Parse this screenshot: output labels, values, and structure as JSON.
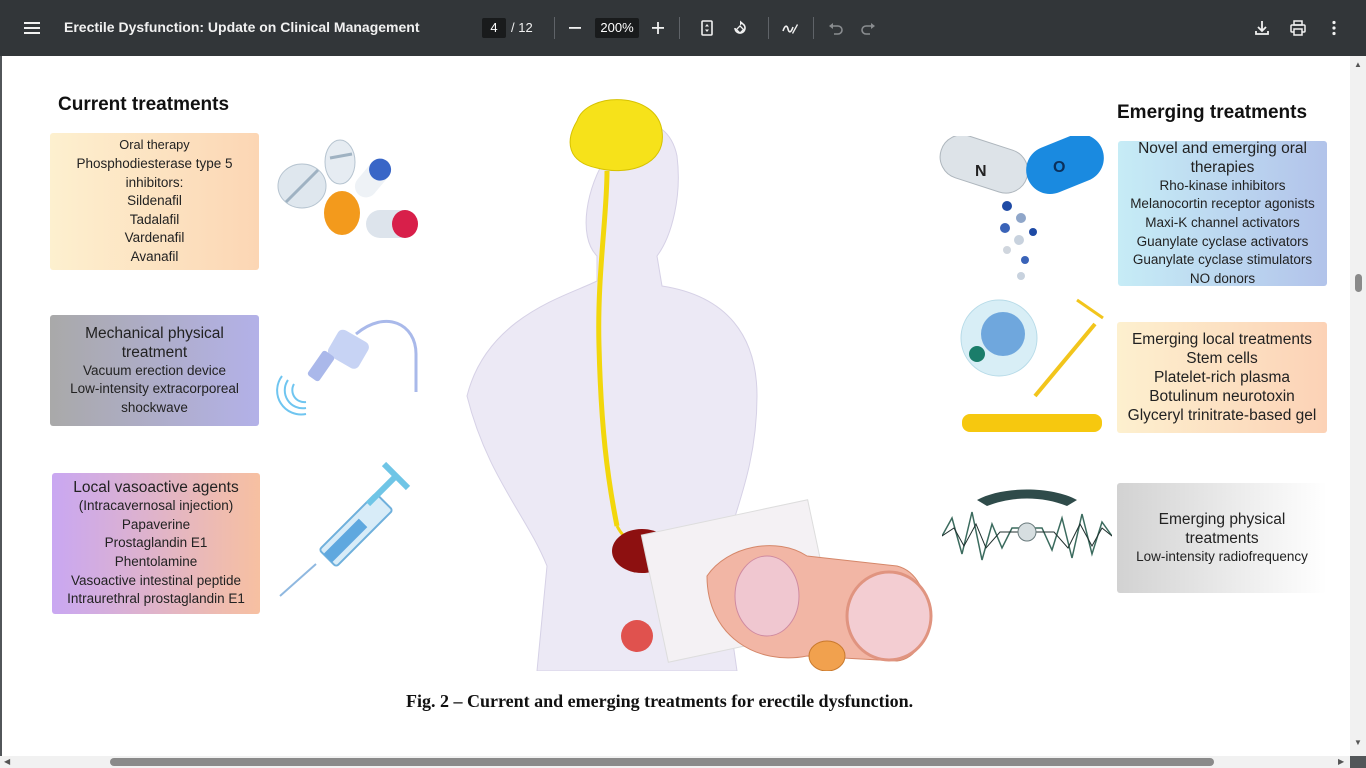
{
  "toolbar": {
    "title": "Erectile Dysfunction: Update on Clinical Management",
    "current_page": "4",
    "total_pages": "/ 12",
    "zoom": "200%"
  },
  "figure": {
    "current_heading": "Current treatments",
    "emerging_heading": "Emerging treatments",
    "oral": {
      "lines": [
        "Oral therapy",
        "Phosphodiesterase type 5",
        "inhibitors:",
        "Sildenafil",
        "Tadalafil",
        "Vardenafil",
        "Avanafil"
      ]
    },
    "mechanical": {
      "title": "Mechanical physical treatment",
      "lines": [
        "Vacuum erection device",
        "Low-intensity extracorporeal",
        "shockwave"
      ]
    },
    "vasoactive": {
      "title": "Local vasoactive agents",
      "lines": [
        "(Intracavernosal injection)",
        "Papaverine",
        "Prostaglandin E1",
        "Phentolamine",
        "Vasoactive intestinal peptide",
        "Intraurethral prostaglandin E1"
      ]
    },
    "emerging_oral": {
      "title": "Novel and emerging oral therapies",
      "lines": [
        "Rho-kinase inhibitors",
        "Melanocortin receptor agonists",
        "Maxi-K channel activators",
        "Guanylate cyclase activators",
        "Guanylate cyclase stimulators",
        "NO donors"
      ]
    },
    "emerging_local": {
      "title": "Emerging local treatments",
      "lines": [
        "Stem cells",
        "Platelet-rich plasma",
        "Botulinum neurotoxin",
        "Glyceryl trinitrate-based gel"
      ]
    },
    "emerging_physical": {
      "title": "Emerging physical treatments",
      "lines": [
        "Low-intensity radiofrequency"
      ]
    },
    "capsule_letters": [
      "N",
      "O"
    ],
    "caption": "Fig. 2 – Current and emerging treatments for erectile dysfunction."
  },
  "icons": [
    "menu-icon",
    "minus-icon",
    "plus-icon",
    "fit-page-icon",
    "rotate-icon",
    "annotate-icon",
    "undo-icon",
    "redo-icon",
    "download-icon",
    "print-icon",
    "more-vert-icon"
  ]
}
